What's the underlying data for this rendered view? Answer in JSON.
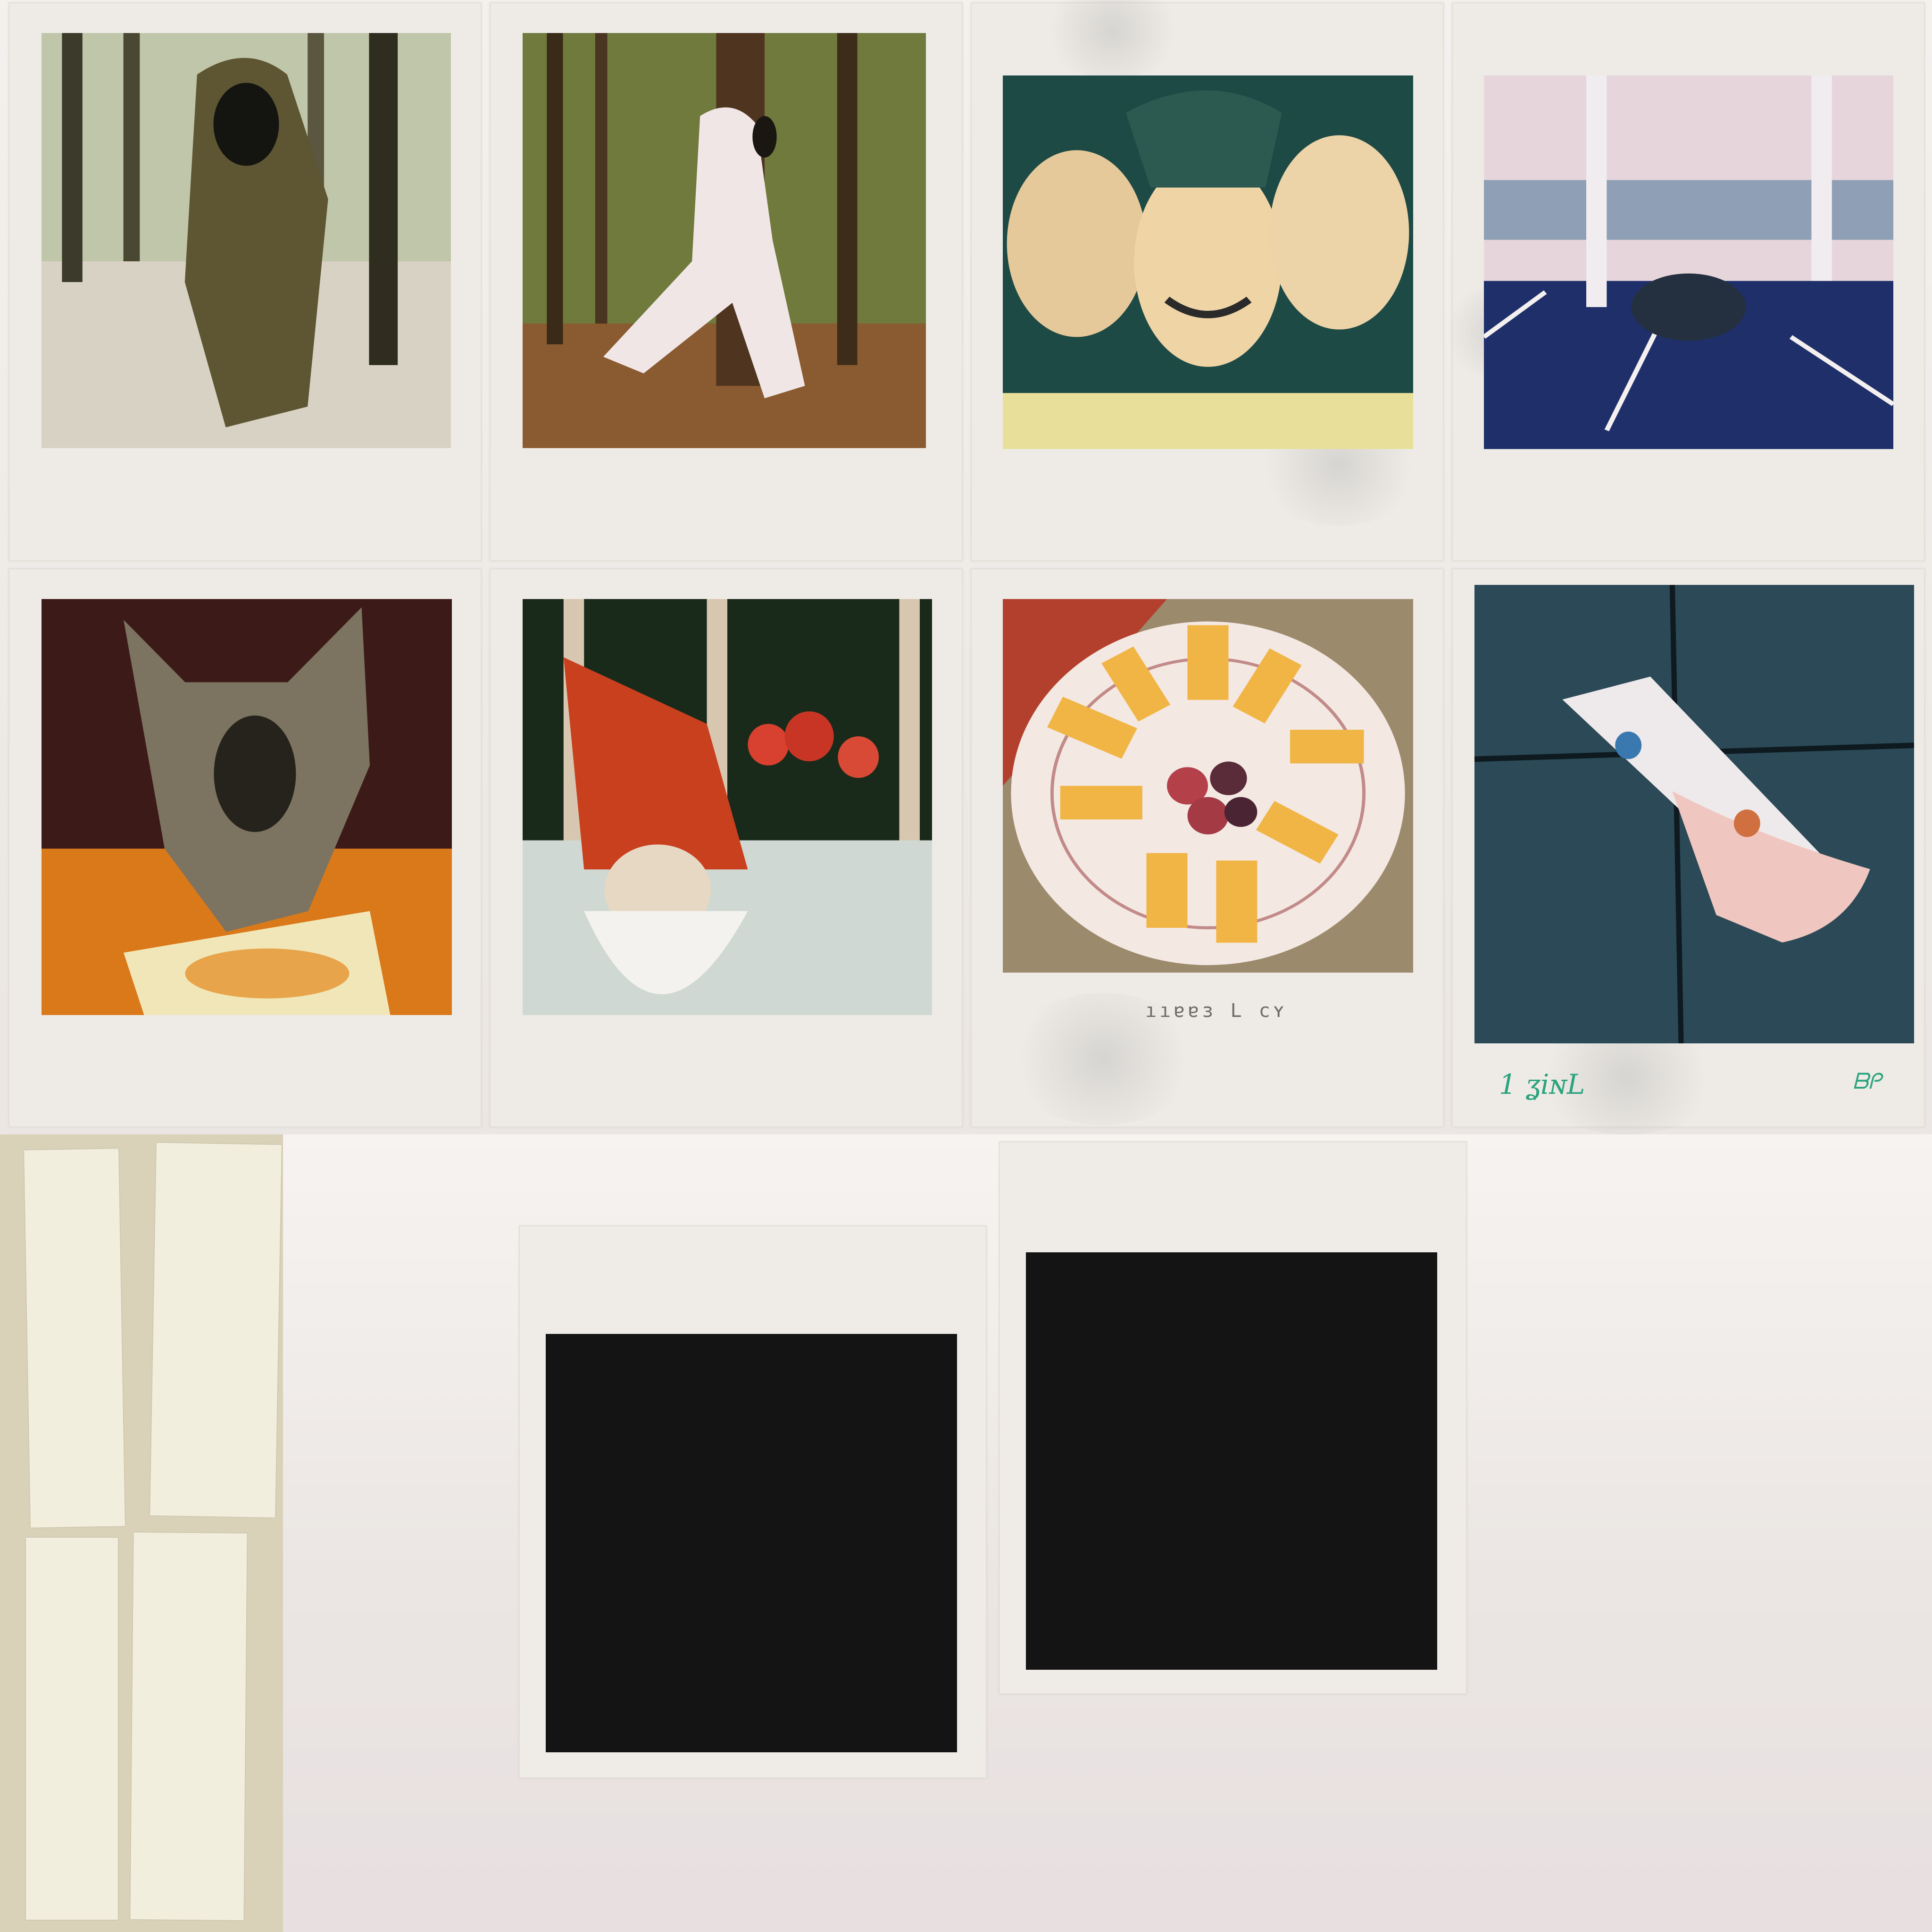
{
  "sheet": {
    "background": "#eeeae6",
    "photos": [
      {
        "name": "photo-forest-hooded-figure",
        "subject": "hooded figure running in winter forest"
      },
      {
        "name": "photo-forest-white-suit",
        "subject": "figure in white suit running through green forest"
      },
      {
        "name": "photo-three-friends-selfie",
        "subject": "three friends smiling selfie"
      },
      {
        "name": "photo-parking-lot-group",
        "subject": "group crouching in empty parking lot"
      },
      {
        "name": "photo-dog-eating",
        "subject": "german shepherd eating from plate"
      },
      {
        "name": "photo-gnome-costume",
        "subject": "person in red gnome hat with white beard"
      },
      {
        "name": "photo-plate-spring-rolls",
        "subject": "plate of spring rolls arranged around grapes"
      },
      {
        "name": "photo-spilled-cup",
        "subject": "spilled cup on pavement"
      }
    ],
    "captions": {
      "plate": "ııɐɐɜ L ϲʏ",
      "spilled_left": "1 ʓiɴL",
      "spilled_right": "ᗷᑭ"
    },
    "blank_polaroids": 2,
    "tape_strips": 4
  }
}
